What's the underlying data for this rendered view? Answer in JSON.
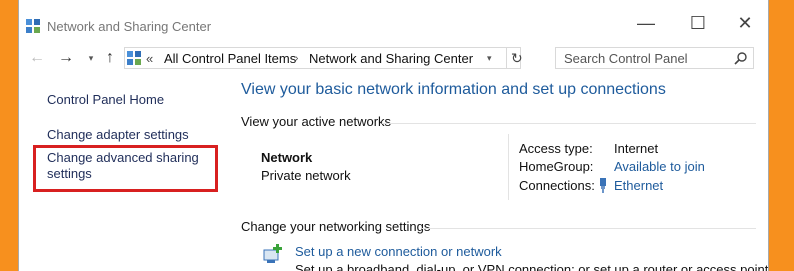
{
  "window": {
    "title": "Network and Sharing Center",
    "controls": {
      "minimize": "—",
      "maximize": "☐",
      "close": "✕"
    }
  },
  "nav": {
    "back_glyph": "←",
    "forward_glyph": "→",
    "recent_glyph": "▾",
    "up_glyph": "↑",
    "address": {
      "overflow_glyph": "«",
      "crumbs": [
        "All Control Panel Items",
        "Network and Sharing Center"
      ],
      "crumb_separator": "›",
      "dropdown_glyph": "▾",
      "refresh_glyph": "↻"
    },
    "search": {
      "placeholder": "Search Control Panel"
    }
  },
  "sidebar": {
    "items": [
      {
        "label": "Control Panel Home"
      },
      {
        "label": "Change adapter settings"
      },
      {
        "label_line1": "Change advanced sharing",
        "label_line2": "settings"
      }
    ],
    "highlight_color": "#d82020"
  },
  "main": {
    "title": "View your basic network information and set up connections",
    "active_networks": {
      "heading": "View your active networks",
      "network_name": "Network",
      "network_type": "Private network",
      "properties": [
        {
          "key": "Access type:",
          "value": "Internet"
        },
        {
          "key": "HomeGroup:",
          "value": "Available to join"
        },
        {
          "key": "Connections:",
          "value": "Ethernet"
        }
      ]
    },
    "change_settings": {
      "heading": "Change your networking settings",
      "setup_link": "Set up a new connection or network",
      "setup_desc": "Set up a broadband, dial-up, or VPN connection; or set up a router or access point."
    }
  },
  "colors": {
    "background": "#F7901E",
    "link": "#1e5b9c",
    "sidebar_link": "#1f2d59"
  },
  "icons": [
    "network-center-icon",
    "back-arrow-icon",
    "forward-arrow-icon",
    "up-arrow-icon",
    "refresh-icon",
    "search-icon",
    "ethernet-icon",
    "new-connection-icon"
  ]
}
